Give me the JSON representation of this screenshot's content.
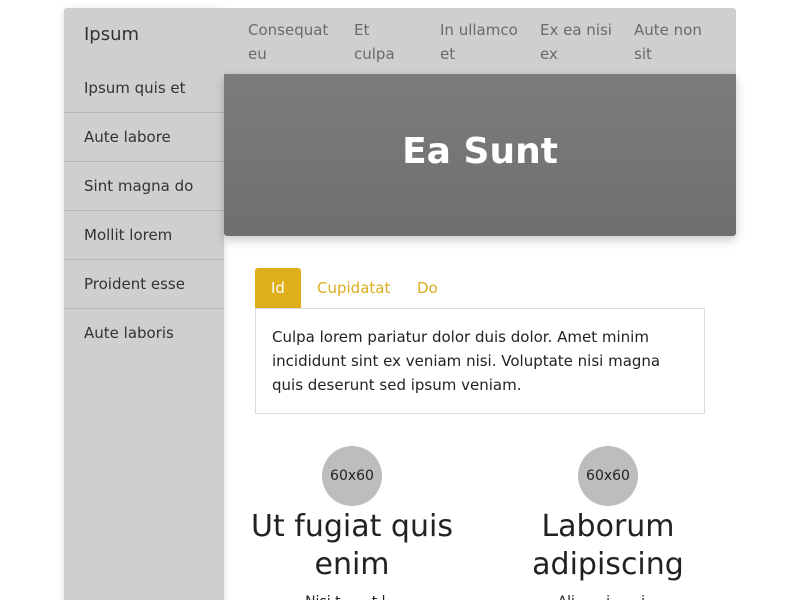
{
  "sidebar": {
    "title": "Ipsum",
    "items": [
      {
        "label": "Ipsum quis et"
      },
      {
        "label": "Aute labore"
      },
      {
        "label": "Sint magna do"
      },
      {
        "label": "Mollit lorem"
      },
      {
        "label": "Proident esse"
      },
      {
        "label": "Aute laboris"
      }
    ]
  },
  "topnav": {
    "items": [
      {
        "label": "Consequat eu"
      },
      {
        "label": "Et culpa ea"
      },
      {
        "label": "In ullamco et"
      },
      {
        "label": "Ex ea nisi ex"
      },
      {
        "label": "Aute non sit"
      }
    ]
  },
  "hero": {
    "title": "Ea Sunt"
  },
  "tabs": {
    "items": [
      {
        "label": "Id",
        "active": true
      },
      {
        "label": "Cupidatat",
        "active": false
      },
      {
        "label": "Do",
        "active": false
      }
    ],
    "active_content": "Culpa lorem pariatur dolor duis dolor. Amet minim incididunt sint ex veniam nisi. Voluptate nisi magna quis deserunt sed ipsum veniam."
  },
  "features": [
    {
      "avatar": "60x60",
      "title": "Ut fugiat quis enim",
      "text": "Nisi t... ...t l..."
    },
    {
      "avatar": "60x60",
      "title": "Laborum adipiscing",
      "text": "Ali... ...i... ...i..."
    }
  ],
  "colors": {
    "accent": "#dfaf1b",
    "sidebar_bg": "#d0cfce",
    "hero_bg": "#767676"
  }
}
